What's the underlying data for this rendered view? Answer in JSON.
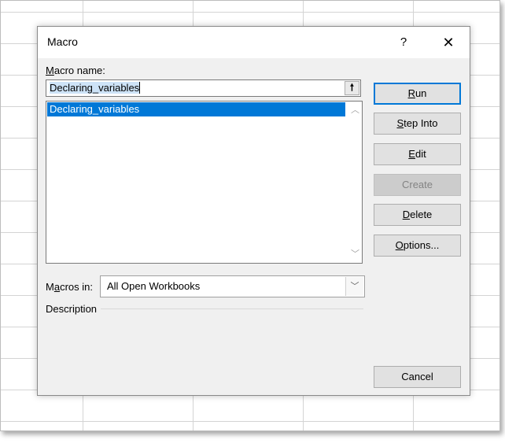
{
  "dialog": {
    "title": "Macro",
    "help": "?",
    "close": "✕"
  },
  "macro_name": {
    "label_first": "M",
    "label_rest": "acro name:",
    "value": "Declaring_variables"
  },
  "list": {
    "items": [
      "Declaring_variables"
    ],
    "selected_index": 0
  },
  "buttons": {
    "run": {
      "u": "R",
      "rest": "un"
    },
    "step_into": {
      "u": "S",
      "rest": "tep Into"
    },
    "edit": {
      "u": "E",
      "rest": "dit"
    },
    "create": "Create",
    "delete": {
      "u": "D",
      "rest": "elete"
    },
    "options": {
      "u": "O",
      "rest": "ptions..."
    },
    "cancel": "Cancel"
  },
  "macros_in": {
    "label_pre": "M",
    "label_u": "a",
    "label_post": "cros in:",
    "value": "All Open Workbooks"
  },
  "description": {
    "label": "Description"
  },
  "colors": {
    "accent": "#0078d7",
    "dialog_bg": "#f0f0f0"
  }
}
